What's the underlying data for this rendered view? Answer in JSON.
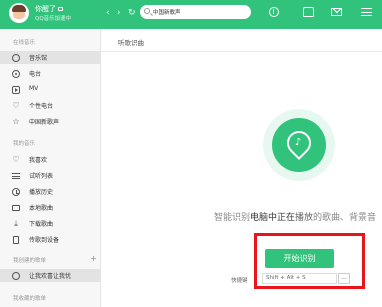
{
  "header": {
    "username": "你醒了",
    "sub_status": "QQ音乐加速中",
    "search_value": "中国新歌声",
    "nav_back_icon": "chevron-left-icon",
    "nav_forward_icon": "chevron-right-icon",
    "refresh_icon": "refresh-icon",
    "accent_color": "#31c27c"
  },
  "sidebar": {
    "online_title": "在线音乐",
    "online_items": [
      {
        "label": "音乐馆",
        "icon": "music-hall-icon",
        "active": true
      },
      {
        "label": "电台",
        "icon": "radio-icon"
      },
      {
        "label": "MV",
        "icon": "mv-icon"
      },
      {
        "label": "个性电台",
        "icon": "heart-icon"
      },
      {
        "label": "中国新歌声",
        "icon": "star-icon"
      }
    ],
    "my_music_title": "我的音乐",
    "my_music_items": [
      {
        "label": "我喜欢",
        "icon": "heart-icon"
      },
      {
        "label": "试听列表",
        "icon": "list-icon"
      },
      {
        "label": "播放历史",
        "icon": "clock-icon"
      },
      {
        "label": "本地歌曲",
        "icon": "folder-icon"
      },
      {
        "label": "下载歌曲",
        "icon": "download-icon"
      },
      {
        "label": "传歌到设备",
        "icon": "phone-icon"
      }
    ],
    "created_title": "我创建的歌单",
    "created_items": [
      {
        "label": "让我欢喜让我忧",
        "icon": "user-icon"
      }
    ],
    "collected_title": "我收藏的歌单"
  },
  "main": {
    "page_title": "听歌识曲",
    "status_prefix": "智能识别",
    "status_em1": "电脑中正在",
    "status_em2": "播放",
    "status_suffix": "的歌曲、背景音",
    "start_button": "开始识别",
    "shortcut_label": "快捷键",
    "shortcut_value": "Shift + Alt + S",
    "shortcut_more": "...",
    "highlight_color": "#e8161b"
  }
}
